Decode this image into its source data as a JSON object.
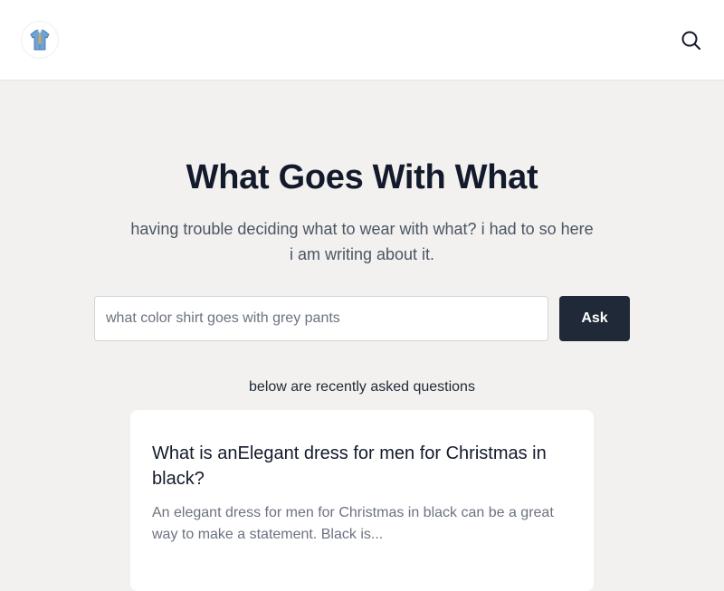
{
  "header": {
    "logo_icon": "shirt-icon",
    "search_icon": "search-icon"
  },
  "hero": {
    "title": "What Goes With What",
    "subtitle": "having trouble deciding what to wear with what? i had to so here i am writing about it."
  },
  "search": {
    "placeholder": "what color shirt goes with grey pants",
    "value": "",
    "button_label": "Ask"
  },
  "recent": {
    "label": "below are recently asked questions",
    "questions": [
      {
        "title": "What is anElegant dress for men for Christmas in black?",
        "excerpt": "An elegant dress for men for Christmas in black can be a great way to make a statement. Black is..."
      }
    ]
  },
  "colors": {
    "background": "#f2f1ef",
    "header": "#ffffff",
    "accent_button": "#1f2937",
    "title_text": "#131a2b"
  }
}
